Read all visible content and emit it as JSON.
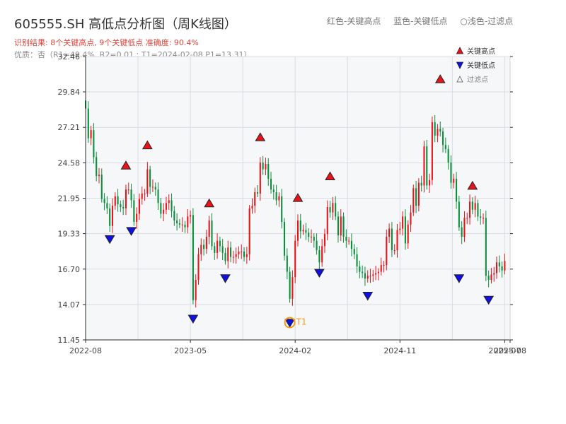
{
  "header": {
    "title": "605555.SH 高低点分析图（周K线图）",
    "legend_red": "红色-关键高点",
    "legend_blue": "蓝色-关键低点",
    "legend_light": "○浅色-过滤点",
    "result_line": "识别结果: 8个关键高点, 9个关键低点   准确度: 90.4%",
    "quality_line": "优质：否（R1=49.4%, R2=0.01 ; T1=2024-02-08 P1=13.31）"
  },
  "colors": {
    "up": "#e8141c",
    "down": "#0a8f3c",
    "high_marker": "#e8141c",
    "low_marker": "#1010e0",
    "t1_ring": "#f39c12",
    "plot_bg": "#f6f7f9",
    "grid": "#d9dde3"
  },
  "chart_data": {
    "type": "candlestick",
    "ylim": [
      11.45,
      32.46
    ],
    "y_ticks": [
      "11.45",
      "14.07",
      "16.70",
      "19.33",
      "21.95",
      "24.58",
      "27.21",
      "29.84",
      "32.46"
    ],
    "x_range_weeks": [
      0,
      158
    ],
    "x_ticks": [
      {
        "label": "2022-08",
        "week": 0
      },
      {
        "label": "2023-05",
        "week": 39
      },
      {
        "label": "2024-02",
        "week": 78
      },
      {
        "label": "2024-11",
        "week": 117
      },
      {
        "label": "2025-07",
        "week": 156
      },
      {
        "label": "2025-08",
        "week": 158
      }
    ],
    "legend": {
      "high": "关键高点",
      "low": "关键低点",
      "filtered": "过滤点"
    },
    "t1_label": "T1",
    "t1_point": {
      "week": 76,
      "price": 13.31
    },
    "key_highs": [
      {
        "week": 15,
        "price": 23.8
      },
      {
        "week": 23,
        "price": 25.3
      },
      {
        "week": 46,
        "price": 21.0
      },
      {
        "week": 65,
        "price": 25.9
      },
      {
        "week": 79,
        "price": 21.4
      },
      {
        "week": 91,
        "price": 23.0
      },
      {
        "week": 132,
        "price": 30.2
      },
      {
        "week": 144,
        "price": 22.3
      }
    ],
    "key_lows": [
      {
        "week": 9,
        "price": 19.5
      },
      {
        "week": 17,
        "price": 20.1
      },
      {
        "week": 40,
        "price": 13.6
      },
      {
        "week": 52,
        "price": 16.6
      },
      {
        "week": 76,
        "price": 13.3
      },
      {
        "week": 87,
        "price": 17.0
      },
      {
        "week": 105,
        "price": 15.3
      },
      {
        "week": 139,
        "price": 16.6
      },
      {
        "week": 150,
        "price": 15.0
      }
    ],
    "close": [
      28.6,
      26.4,
      27.0,
      25.0,
      23.6,
      23.7,
      21.9,
      21.6,
      21.2,
      19.9,
      21.4,
      22.1,
      21.5,
      21.3,
      21.2,
      22.6,
      22.6,
      21.8,
      20.2,
      20.8,
      21.9,
      22.3,
      22.3,
      24.1,
      22.8,
      22.8,
      22.6,
      21.6,
      20.8,
      21.1,
      21.6,
      21.8,
      21.0,
      20.3,
      20.1,
      20.0,
      20.0,
      19.8,
      20.6,
      20.7,
      14.4,
      15.9,
      17.8,
      18.5,
      18.2,
      19.1,
      20.3,
      18.4,
      17.9,
      18.8,
      18.4,
      17.9,
      17.3,
      18.3,
      17.6,
      17.6,
      17.8,
      18.0,
      18.0,
      17.6,
      17.8,
      21.2,
      21.4,
      22.4,
      22.3,
      24.6,
      24.1,
      24.5,
      23.4,
      22.6,
      22.4,
      21.8,
      22.1,
      20.2,
      17.7,
      16.5,
      14.5,
      16.1,
      18.8,
      20.3,
      19.5,
      19.6,
      19.4,
      19.1,
      19.1,
      18.8,
      18.1,
      17.2,
      18.4,
      19.3,
      21.3,
      20.9,
      21.6,
      20.6,
      19.2,
      20.6,
      19.1,
      18.8,
      18.8,
      18.2,
      17.8,
      16.9,
      16.5,
      16.4,
      16.0,
      16.2,
      16.2,
      16.3,
      16.4,
      16.5,
      17.0,
      17.0,
      19.1,
      19.7,
      18.1,
      18.1,
      19.6,
      19.7,
      20.6,
      18.6,
      20.0,
      20.9,
      22.7,
      21.4,
      23.1,
      22.9,
      25.8,
      22.9,
      23.3,
      27.6,
      26.6,
      27.1,
      26.9,
      25.9,
      25.6,
      24.6,
      23.1,
      23.4,
      21.7,
      19.8,
      19.1,
      20.5,
      20.5,
      21.7,
      21.1,
      21.6,
      20.6,
      20.5,
      20.5,
      16.2,
      15.9,
      16.3,
      16.4,
      17.2,
      16.9,
      16.6,
      17.3
    ],
    "filtered_points": []
  }
}
